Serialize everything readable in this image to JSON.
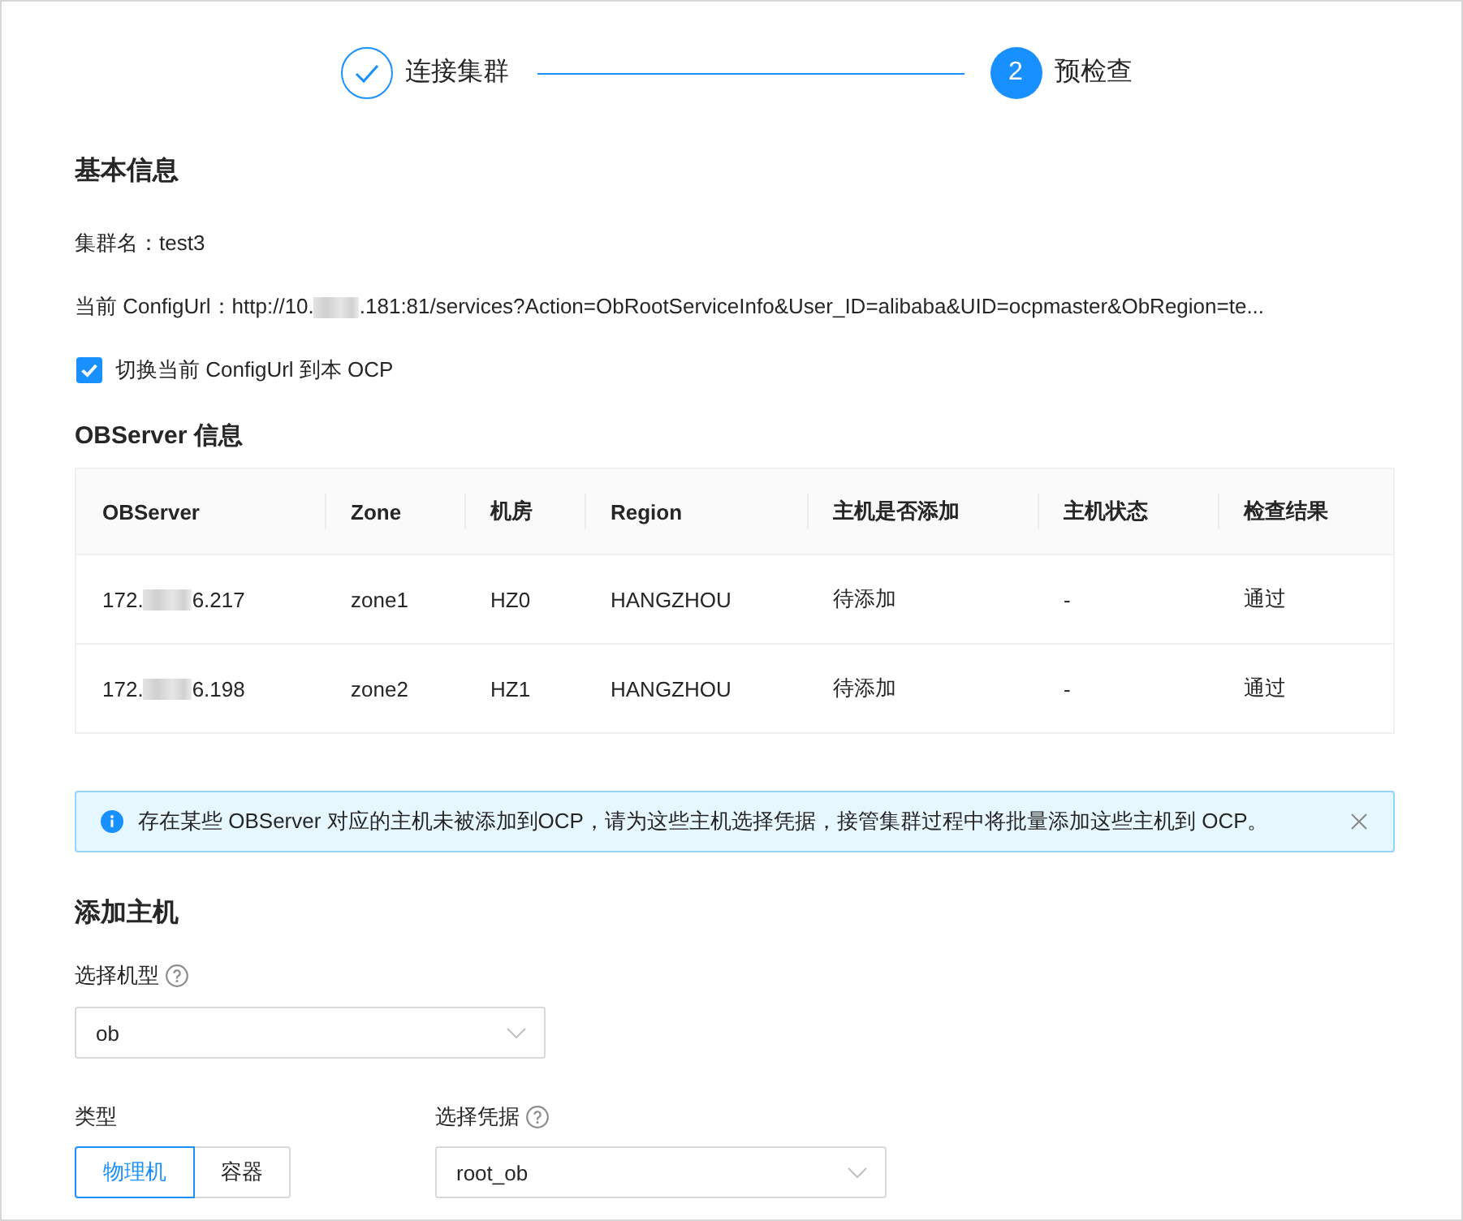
{
  "steps": [
    {
      "label": "连接集群",
      "kind": "done"
    },
    {
      "number": "2",
      "label": "预检查",
      "kind": "current"
    }
  ],
  "basic_info": {
    "title": "基本信息",
    "cluster_name": "集群名：test3",
    "config_url": {
      "label": "当前 ConfigUrl：",
      "value_start": "http://10.",
      "value_end": ".181:81/services?Action=ObRootServiceInfo&User_ID=alibaba&UID=ocpmaster&ObRegion=te..."
    },
    "switch_option": {
      "label": "切换当前 ConfigUrl 到本 OCP",
      "checked": true
    }
  },
  "observer_info": {
    "title": "OBServer 信息",
    "columns": [
      "OBServer",
      "Zone",
      "机房",
      "Region",
      "主机是否添加",
      "主机状态",
      "检查结果"
    ],
    "rows": [
      {
        "cells": [
          {
            "start": "172.",
            "end": "6.217"
          },
          "zone1",
          "HZ0",
          "HANGZHOU",
          "待添加",
          "-",
          "通过"
        ]
      },
      {
        "cells": [
          {
            "start": "172.",
            "end": "6.198"
          },
          "zone2",
          "HZ1",
          "HANGZHOU",
          "待添加",
          "-",
          "通过"
        ]
      }
    ]
  },
  "alert": {
    "kind": "info",
    "message": "存在某些 OBServer 对应的主机未被添加到OCP，请为这些主机选择凭据，接管集群过程中将批量添加这些主机到 OCP。",
    "closable": true
  },
  "add_host": {
    "title": "添加主机",
    "machine_type": {
      "label": "选择机型",
      "help": true,
      "value": "ob"
    },
    "host_type": {
      "label": "类型",
      "options": [
        {
          "label": "物理机",
          "selected": true
        },
        {
          "label": "容器",
          "selected": false
        }
      ]
    },
    "credential": {
      "label": "选择凭据",
      "help": true,
      "value": "root_ob"
    }
  }
}
